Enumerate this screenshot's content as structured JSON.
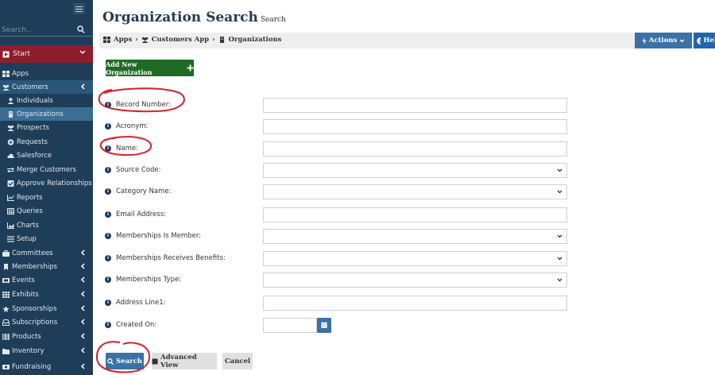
{
  "sidebar": {
    "search_placeholder": "Search...",
    "start_label": "Start",
    "items": [
      {
        "label": "Apps"
      },
      {
        "label": "Customers"
      },
      {
        "label": "Individuals"
      },
      {
        "label": "Organizations"
      },
      {
        "label": "Prospects"
      },
      {
        "label": "Requests"
      },
      {
        "label": "Salesforce"
      },
      {
        "label": "Merge Customers"
      },
      {
        "label": "Approve Relationships"
      },
      {
        "label": "Reports"
      },
      {
        "label": "Queries"
      },
      {
        "label": "Charts"
      },
      {
        "label": "Setup"
      },
      {
        "label": "Committees"
      },
      {
        "label": "Memberships"
      },
      {
        "label": "Events"
      },
      {
        "label": "Exhibits"
      },
      {
        "label": "Sponsorships"
      },
      {
        "label": "Subscriptions"
      },
      {
        "label": "Products"
      },
      {
        "label": "Inventory"
      },
      {
        "label": "Fundraising"
      }
    ]
  },
  "header": {
    "title": "Organization Search",
    "subtitle": "Search",
    "breadcrumb": [
      "Apps",
      "Customers App",
      "Organizations"
    ],
    "actions_label": "Actions",
    "help_label": "Help"
  },
  "add_button_label": "Add New Organization",
  "form": {
    "fields": [
      {
        "label": "Record Number:",
        "type": "text",
        "value": ""
      },
      {
        "label": "Acronym:",
        "type": "text",
        "value": ""
      },
      {
        "label": "Name:",
        "type": "text",
        "value": ""
      },
      {
        "label": "Source Code:",
        "type": "select",
        "value": ""
      },
      {
        "label": "Category Name:",
        "type": "select",
        "value": ""
      },
      {
        "label": "Email Address:",
        "type": "text",
        "value": ""
      },
      {
        "label": "Memberships Is Member:",
        "type": "select",
        "value": ""
      },
      {
        "label": "Memberships Receives Benefits:",
        "type": "select",
        "value": ""
      },
      {
        "label": "Memberships Type:",
        "type": "select",
        "value": ""
      },
      {
        "label": "Address Line1:",
        "type": "text",
        "value": ""
      },
      {
        "label": "Created On:",
        "type": "date",
        "value": ""
      }
    ]
  },
  "buttons": {
    "search": "Search",
    "advanced": "Advanced View",
    "cancel": "Cancel"
  },
  "colors": {
    "sidebar_bg": "#1e3d58",
    "start_bg": "#8e1d2c",
    "primary": "#3a71a8",
    "add_green": "#1f6b25",
    "annotation_red": "#d8202a"
  }
}
